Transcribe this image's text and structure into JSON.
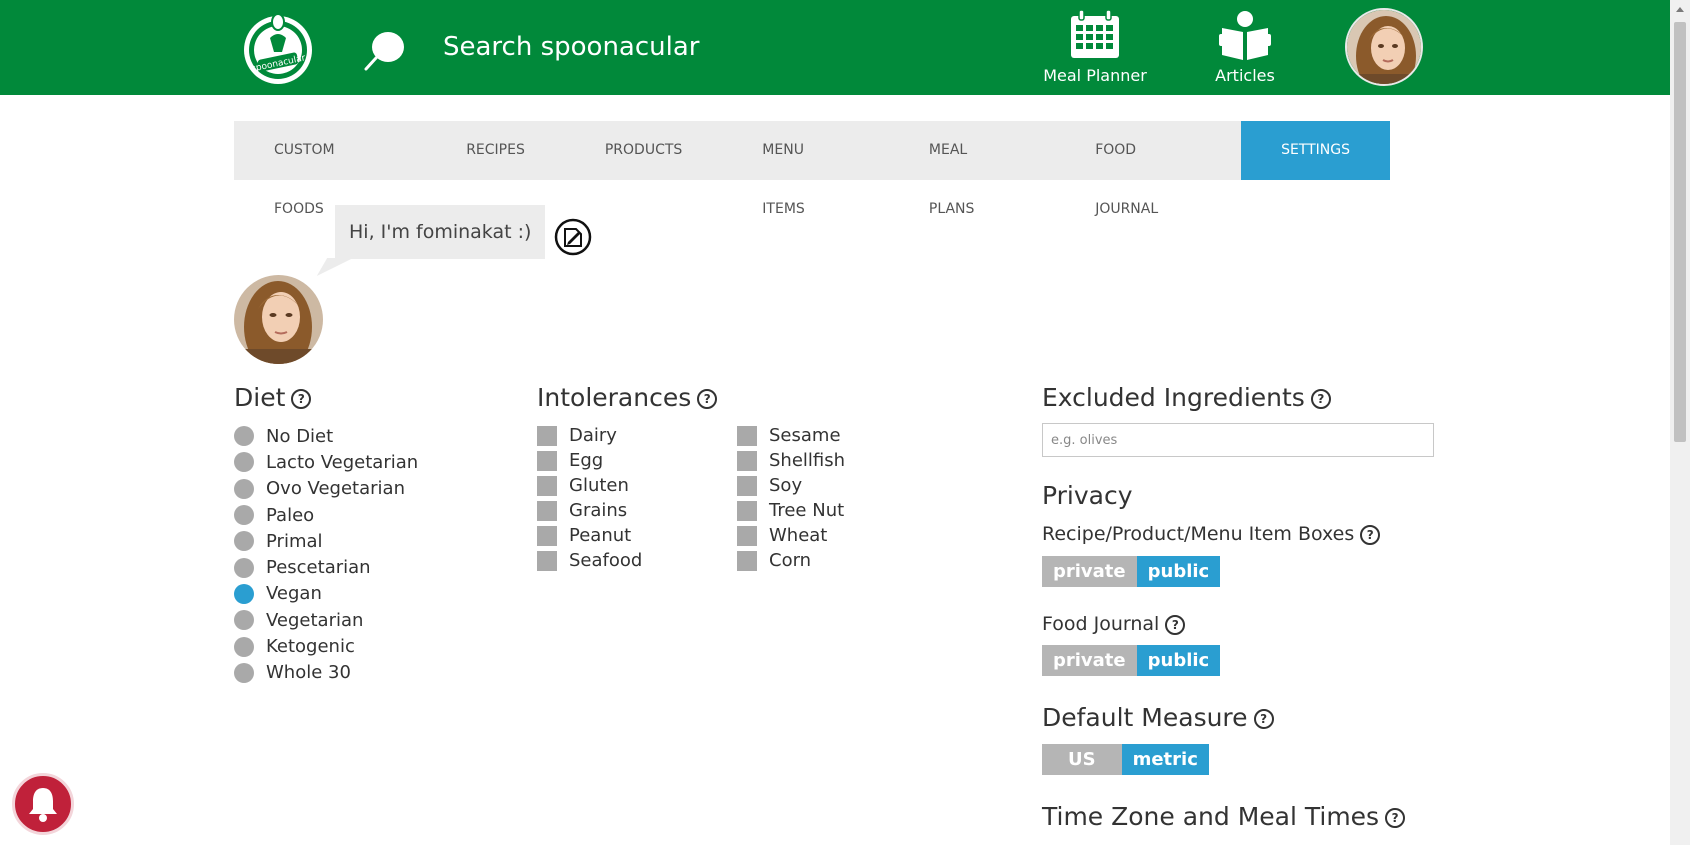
{
  "header": {
    "search_placeholder": "Search spoonacular",
    "logo_text": "spoonacular",
    "meal_planner_label": "Meal Planner",
    "articles_label": "Articles",
    "brand_color": "#01893a"
  },
  "tabs": [
    {
      "label": "CUSTOM FOODS"
    },
    {
      "label": "RECIPES"
    },
    {
      "label": "PRODUCTS"
    },
    {
      "label": "MENU ITEMS"
    },
    {
      "label": "MEAL PLANS"
    },
    {
      "label": "FOOD JOURNAL"
    },
    {
      "label": "SETTINGS",
      "active": true
    }
  ],
  "profile": {
    "greeting": "Hi, I'm fominakat :)"
  },
  "diet": {
    "title": "Diet",
    "options": [
      "No Diet",
      "Lacto Vegetarian",
      "Ovo Vegetarian",
      "Paleo",
      "Primal",
      "Pescetarian",
      "Vegan",
      "Vegetarian",
      "Ketogenic",
      "Whole 30"
    ],
    "selected": "Vegan"
  },
  "intolerances": {
    "title": "Intolerances",
    "col1": [
      "Dairy",
      "Egg",
      "Gluten",
      "Grains",
      "Peanut",
      "Seafood"
    ],
    "col2": [
      "Sesame",
      "Shellfish",
      "Soy",
      "Tree Nut",
      "Wheat",
      "Corn"
    ]
  },
  "excluded": {
    "title": "Excluded Ingredients",
    "placeholder": "e.g. olives"
  },
  "privacy": {
    "title": "Privacy",
    "boxes_label": "Recipe/Product/Menu Item Boxes",
    "journal_label": "Food Journal",
    "private_label": "private",
    "public_label": "public"
  },
  "measure": {
    "title": "Default Measure",
    "us_label": "US",
    "metric_label": "metric"
  },
  "timezone": {
    "title": "Time Zone and Meal Times"
  },
  "colors": {
    "accent": "#2a9ed1",
    "inactive": "#a9a9a9"
  }
}
